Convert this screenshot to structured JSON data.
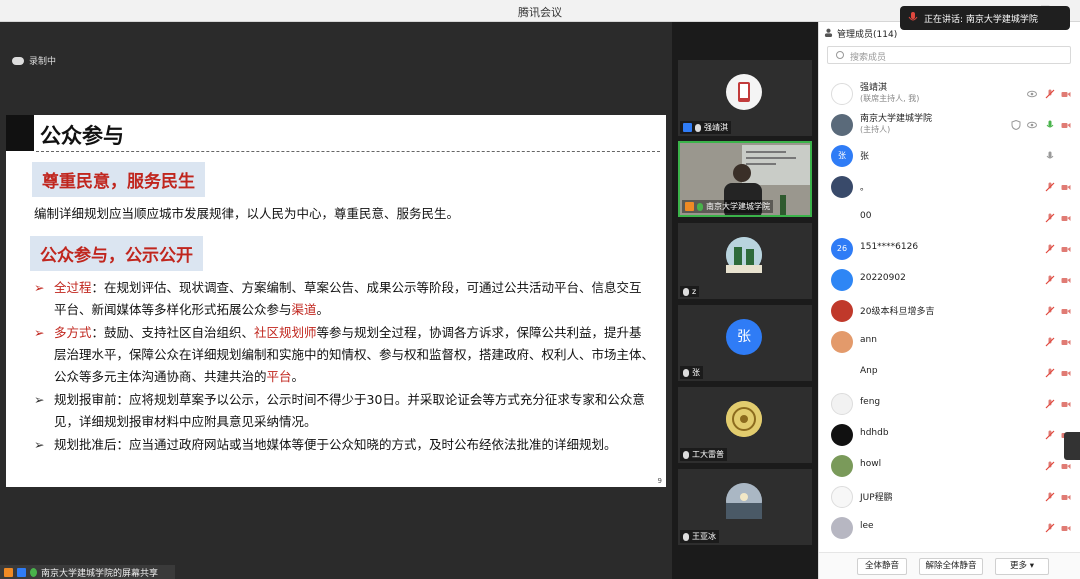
{
  "window": {
    "title": "腾讯会议",
    "controls": [
      "—",
      "□",
      "×"
    ]
  },
  "toast": {
    "text": "正在讲话: 南京大学建城学院"
  },
  "recording": {
    "label": "录制中"
  },
  "slide": {
    "title": "公众参与",
    "section1": "尊重民意，服务民生",
    "para1": "编制详细规划应当顺应城市发展规律，以人民为中心，尊重民意、服务民生。",
    "section2": "公众参与，公示公开",
    "b1_head": "全过程",
    "b1_text": "：在规划评估、现状调查、方案编制、草案公告、成果公示等阶段，可通过公共活动平台、信息交互平台、新闻媒体等多样化形式拓展公众参与",
    "b1_red": "渠道",
    "b1_end": "。",
    "b2_head": "多方式",
    "b2_text1": "：鼓励、支持社区自治组织、",
    "b2_red1": "社区规划师",
    "b2_text2": "等参与规划全过程，协调各方诉求，保障公共利益，提升基层治理水平，保障公众在详细规划编制和实施中的知情权、参与权和监督权，搭建政府、权利人、市场主体、公众等多元主体沟通协商、共建共治的",
    "b2_red2": "平台",
    "b2_end": "。",
    "b3": "规划报审前：应将规划草案予以公示，公示时间不得少于30日。并采取论证会等方式充分征求专家和公众意见，详细规划报审材料中应附具意见采纳情况。",
    "b4": "规划批准后：应当通过政府网站或当地媒体等便于公众知晓的方式，及时公布经依法批准的详细规划。",
    "page": "9"
  },
  "share_bar": {
    "label": "南京大学建城学院的屏幕共享"
  },
  "video_tiles": [
    {
      "name": "强靖淇"
    },
    {
      "name": "南京大学建城学院"
    },
    {
      "name": "z"
    },
    {
      "name": "张",
      "avatar_text": "张"
    },
    {
      "name": "工大雷普"
    },
    {
      "name": "王亚冰"
    }
  ],
  "panel": {
    "header": "管理成员(114)",
    "search_placeholder": "搜索成员",
    "members": [
      {
        "name": "强靖淇",
        "role": "(联席主持人, 我)"
      },
      {
        "name": "南京大学建城学院",
        "role": "(主持人)"
      },
      {
        "name": "张",
        "avatar_text": "张"
      },
      {
        "name": "。"
      },
      {
        "name": "00"
      },
      {
        "name": "151****6126",
        "avatar_text": "26"
      },
      {
        "name": "20220902"
      },
      {
        "name": "20级本科旦增多吉"
      },
      {
        "name": "ann"
      },
      {
        "name": "Anp"
      },
      {
        "name": "feng"
      },
      {
        "name": "hdhdb"
      },
      {
        "name": "howl"
      },
      {
        "name": "JUP程鹏"
      },
      {
        "name": "lee"
      }
    ],
    "buttons": {
      "mute_all": "全体静音",
      "unmute_all": "解除全体静音",
      "more": "更多 ▾"
    }
  },
  "colors": {
    "accent_red": "#c0261e",
    "slide_box": "#dbe5f1",
    "active_green": "#3bb34a",
    "brand_blue": "#2f7cf6"
  }
}
